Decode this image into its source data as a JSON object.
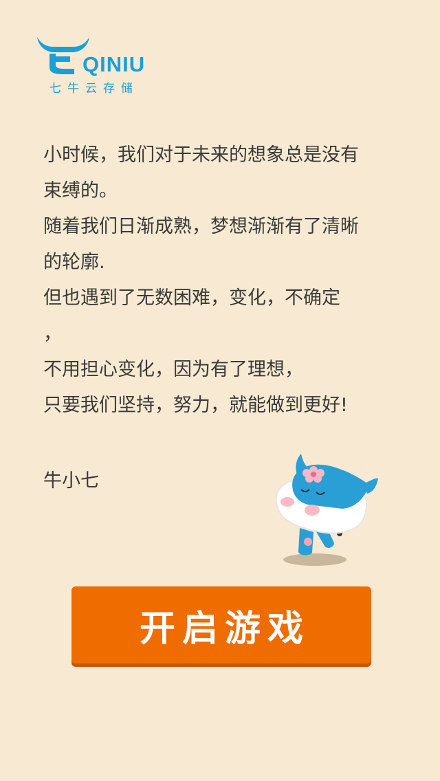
{
  "logo": {
    "brand": "QINIU",
    "tagline": "七牛云存储"
  },
  "message": {
    "lines": [
      "小时候，我们对于未来的想象总是没有",
      "束缚的。",
      "随着我们日渐成熟，梦想渐渐有了清晰",
      "的轮廓.",
      "但也遇到了无数困难，变化，不确定",
      "，",
      "不用担心变化，因为有了理想，",
      "只要我们坚持，努力，就能做到更好!"
    ],
    "signature": "牛小七"
  },
  "button": {
    "label": "开启游戏"
  },
  "colors": {
    "background": "#f8ead2",
    "brand_blue": "#1aa0d9",
    "button_orange": "#ef6c00",
    "text": "#3a3a3a"
  },
  "icons": {
    "logo_mark": "qiniu-bull-horns-icon",
    "mascot": "niu-xiaoqi-mascot"
  }
}
